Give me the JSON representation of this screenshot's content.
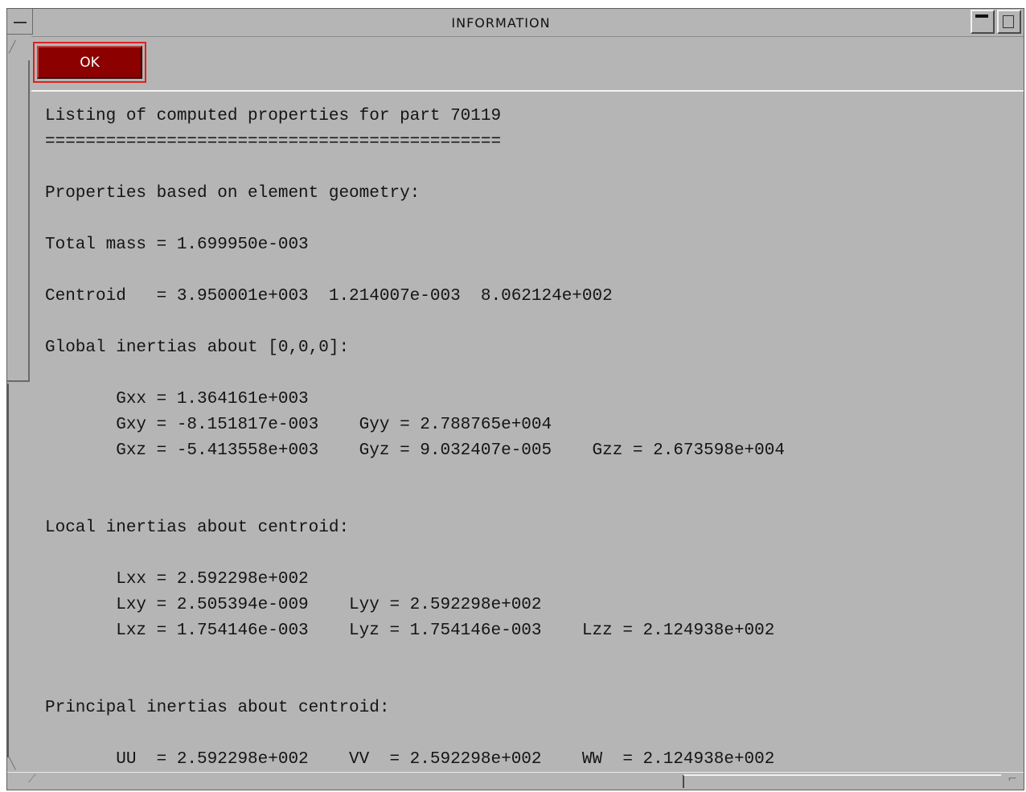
{
  "window": {
    "title": "INFORMATION"
  },
  "toolbar": {
    "ok_label": "OK"
  },
  "info": {
    "lines": [
      "Listing of computed properties for part 70119",
      "=============================================",
      "",
      "Properties based on element geometry:",
      "",
      "Total mass = 1.699950e-003",
      "",
      "Centroid   = 3.950001e+003  1.214007e-003  8.062124e+002",
      "",
      "Global inertias about [0,0,0]:",
      "",
      "       Gxx = 1.364161e+003",
      "       Gxy = -8.151817e-003    Gyy = 2.788765e+004",
      "       Gxz = -5.413558e+003    Gyz = 9.032407e-005    Gzz = 2.673598e+004",
      "",
      "",
      "Local inertias about centroid:",
      "",
      "       Lxx = 2.592298e+002",
      "       Lxy = 2.505394e-009    Lyy = 2.592298e+002",
      "       Lxz = 1.754146e-003    Lyz = 1.754146e-003    Lzz = 2.124938e+002",
      "",
      "",
      "Principal inertias about centroid:",
      "",
      "       UU  = 2.592298e+002    VV  = 2.592298e+002    WW  = 2.124938e+002"
    ]
  }
}
